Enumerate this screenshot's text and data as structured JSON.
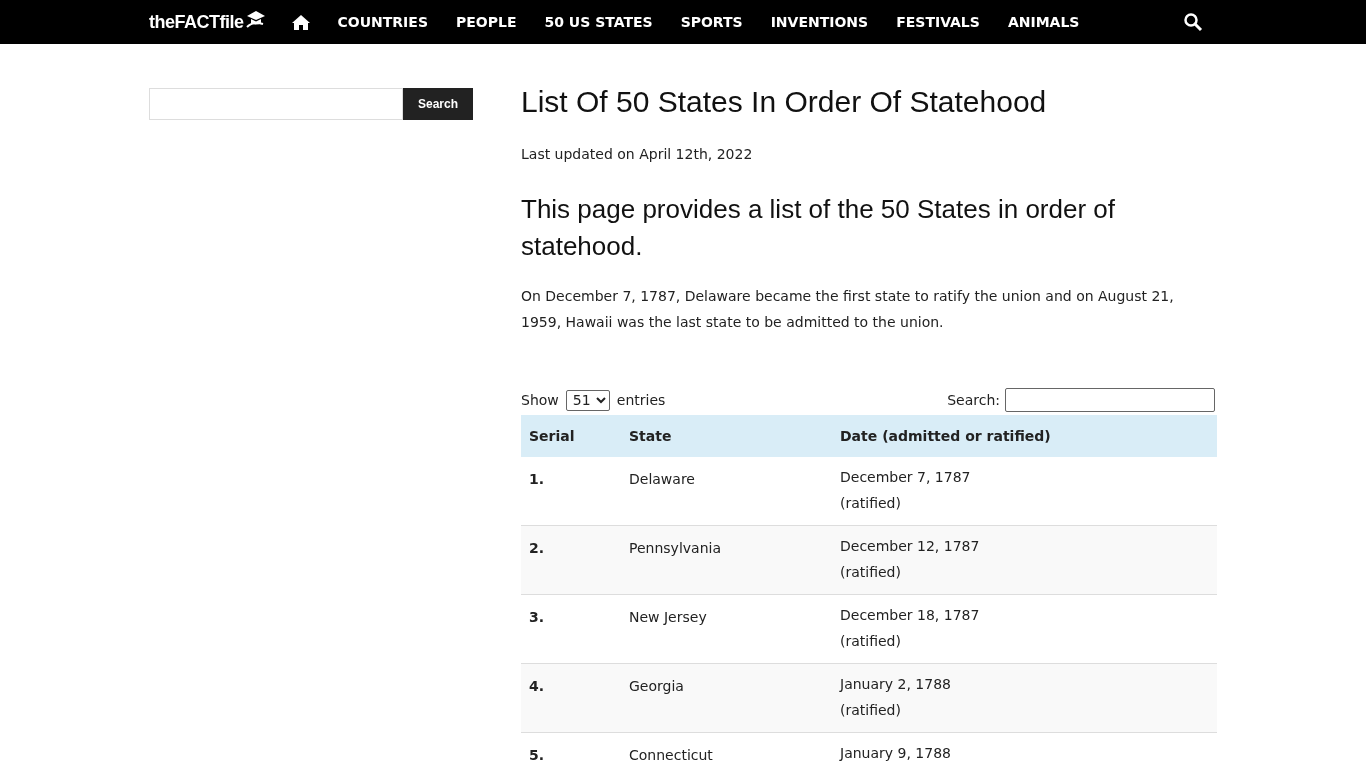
{
  "header": {
    "logo": "theFACTfile",
    "nav": [
      "COUNTRIES",
      "PEOPLE",
      "50 US STATES",
      "SPORTS",
      "INVENTIONS",
      "FESTIVALS",
      "ANIMALS"
    ]
  },
  "sidebar": {
    "search_button": "Search"
  },
  "article": {
    "title": "List Of 50 States In Order Of Statehood",
    "updated": "Last updated on April 12th, 2022",
    "lead": "This page provides a list of the 50 States in order of statehood.",
    "paragraph": "On December 7, 1787, Delaware became the first state to ratify the union and on August 21, 1959, Hawaii was the last state to be admitted to the union."
  },
  "table": {
    "show_label": "Show",
    "show_value": "51",
    "entries_label": "entries",
    "search_label": "Search:",
    "columns": [
      "Serial",
      "State",
      "Date (admitted or ratified)"
    ],
    "rows": [
      {
        "serial": "1.",
        "state": "Delaware",
        "date": "December 7, 1787",
        "note": "(ratified)"
      },
      {
        "serial": "2.",
        "state": "Pennsylvania",
        "date": "December 12, 1787",
        "note": "(ratified)"
      },
      {
        "serial": "3.",
        "state": "New Jersey",
        "date": "December 18, 1787",
        "note": "(ratified)"
      },
      {
        "serial": "4.",
        "state": "Georgia",
        "date": "January 2, 1788",
        "note": "(ratified)"
      },
      {
        "serial": "5.",
        "state": "Connecticut",
        "date": "January 9, 1788"
      }
    ]
  }
}
